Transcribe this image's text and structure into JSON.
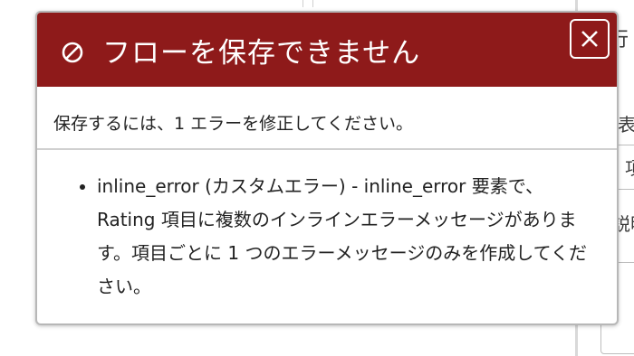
{
  "dialog": {
    "title": "フローを保存できません",
    "close_icon": "close-icon",
    "header_icon": "block-icon",
    "summary": "保存するには、1 エラーを修正してください。",
    "errors": [
      "inline_error (カスタムエラー) - inline_error 要素で、Rating 項目に複数のインラインエラーメッセージがあります。項目ごとに 1 つのエラーメッセージのみを作成してください。"
    ]
  },
  "background": {
    "labels": [
      "行",
      "表",
      "項",
      "説明"
    ]
  },
  "colors": {
    "header_bg": "#8e1a1a",
    "header_text": "#ffffff",
    "border": "#b7b7b7"
  }
}
